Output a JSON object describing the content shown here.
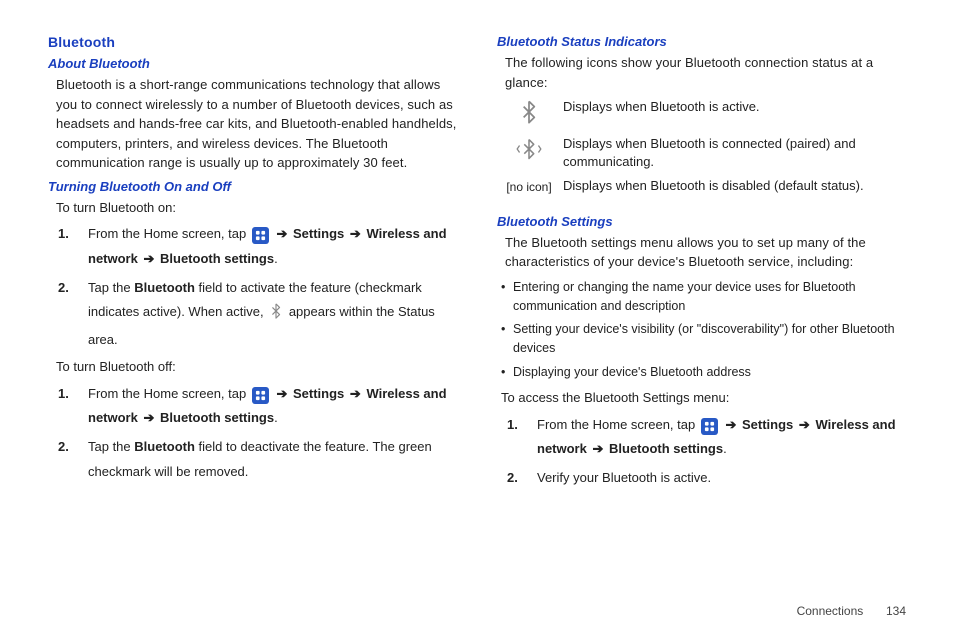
{
  "left": {
    "h1": "Bluetooth",
    "about_h": "About Bluetooth",
    "about_body": "Bluetooth is a short-range communications technology that allows you to connect wirelessly to a number of Bluetooth devices, such as headsets and hands-free car kits, and Bluetooth-enabled handhelds, computers, printers, and wireless devices. The Bluetooth communication range is usually up to approximately 30 feet.",
    "onoff_h": "Turning Bluetooth On and Off",
    "on_lead": "To turn Bluetooth on:",
    "on_step1_a": "From the Home screen, tap ",
    "settings": "Settings",
    "wireless": "Wireless and network",
    "btsettings": "Bluetooth settings",
    "on_step2_a": "Tap the ",
    "bluetooth_bold": "Bluetooth",
    "on_step2_b": " field to activate the feature (checkmark indicates active). When active, ",
    "on_step2_c": " appears within the Status area.",
    "off_lead": "To turn Bluetooth off:",
    "off_step2": " field to deactivate the feature. The green checkmark will be removed."
  },
  "right": {
    "status_h": "Bluetooth Status Indicators",
    "status_lead": "The following icons show your Bluetooth connection status at a glance:",
    "row1": "Displays when Bluetooth is active.",
    "row2": "Displays when Bluetooth is connected (paired) and communicating.",
    "row3_label": "[no icon]",
    "row3": "Displays when Bluetooth is disabled (default status).",
    "settings_h": "Bluetooth Settings",
    "settings_lead": "The Bluetooth settings menu allows you to set up many of the characteristics of your device's Bluetooth service, including:",
    "b1": "Entering or changing the name your device uses for Bluetooth communication and description",
    "b2": "Setting your device's visibility (or \"discoverability\") for other Bluetooth devices",
    "b3": "Displaying your device's Bluetooth address",
    "access_lead": "To access the Bluetooth Settings menu:",
    "access_step2": "Verify your Bluetooth is active."
  },
  "footer": {
    "section": "Connections",
    "page": "134"
  }
}
